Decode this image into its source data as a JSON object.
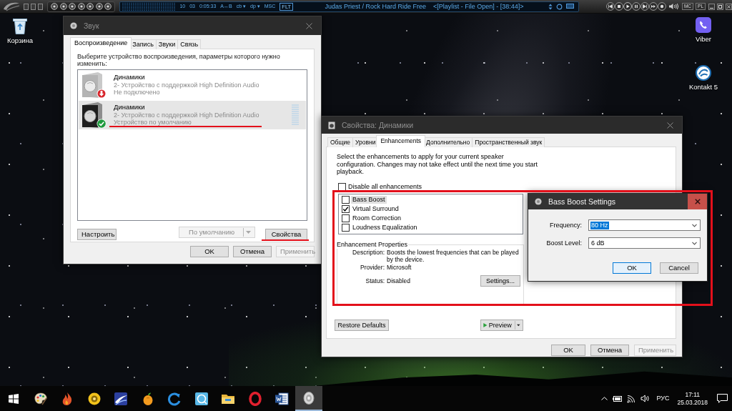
{
  "media_player": {
    "readouts": [
      "10",
      "03",
      "0:05:33",
      "A↔B",
      "cb ▾",
      "dp ▾",
      "MSC"
    ],
    "badge": "FLT",
    "title": "Judas Priest / Rock Hard Ride Free",
    "status": "<[Playlist - File Open] - [38:44]>",
    "buttons": [
      "MC",
      "PL"
    ]
  },
  "desktop_icons": [
    {
      "label": "Корзина",
      "kind": "bin"
    },
    {
      "label": "Viber",
      "kind": "phone"
    },
    {
      "label": "Kontakt 5",
      "kind": "swirl"
    }
  ],
  "sound_window": {
    "title": "Звук",
    "active": false,
    "tabs": [
      {
        "label": "Воспроизведение",
        "selected": true
      },
      {
        "label": "Запись",
        "selected": false
      },
      {
        "label": "Звуки",
        "selected": false
      },
      {
        "label": "Связь",
        "selected": false
      }
    ],
    "instruction": "Выберите устройство воспроизведения, параметры которого нужно изменить:",
    "devices": [
      {
        "name": "Динамики",
        "description": "2- Устройство с поддержкой High Definition Audio",
        "status": "Не подключено",
        "kind": "disconnected",
        "selected": false,
        "underlined": false
      },
      {
        "name": "Динамики",
        "description": "2- Устройство с поддержкой High Definition Audio",
        "status": "Устройство по умолчанию",
        "kind": "default",
        "selected": true,
        "underlined": true
      }
    ],
    "actions": [
      {
        "label": "Настроить",
        "kind": "button",
        "disabled": false,
        "underlined": false
      },
      {
        "label": "По умолчанию",
        "kind": "split",
        "disabled": true,
        "underlined": false
      },
      {
        "label": "Свойства",
        "kind": "button",
        "disabled": false,
        "underlined": true
      }
    ],
    "buttons": [
      {
        "label": "OK",
        "disabled": false
      },
      {
        "label": "Отмена",
        "disabled": false
      },
      {
        "label": "Применить",
        "disabled": true
      }
    ]
  },
  "properties_window": {
    "title": "Свойства: Динамики",
    "active": false,
    "tabs": [
      {
        "label": "Общие",
        "selected": false
      },
      {
        "label": "Уровни",
        "selected": false
      },
      {
        "label": "Enhancements",
        "selected": true
      },
      {
        "label": "Дополнительно",
        "selected": false
      },
      {
        "label": "Пространственный звук",
        "selected": false
      }
    ],
    "intro": "Select the enhancements to apply for your current speaker configuration. Changes may not take effect until the next time you start playback.",
    "disable_all": {
      "label": "Disable all enhancements",
      "checked": false
    },
    "enhancements": [
      {
        "label": "Bass Boost",
        "checked": false,
        "selected": true
      },
      {
        "label": "Virtual Surround",
        "checked": true,
        "selected": false
      },
      {
        "label": "Room Correction",
        "checked": false,
        "selected": false
      },
      {
        "label": "Loudness Equalization",
        "checked": false,
        "selected": false
      }
    ],
    "group": {
      "title": "Enhancement Properties",
      "description_label": "Description:",
      "description": "Boosts the lowest frequencies that can be played by the device.",
      "provider_label": "Provider:",
      "provider": "Microsoft",
      "status_label": "Status:",
      "status": "Disabled",
      "settings_button": "Settings..."
    },
    "restore_button": "Restore Defaults",
    "preview_button": "Preview",
    "buttons": [
      {
        "label": "OK",
        "disabled": false
      },
      {
        "label": "Отмена",
        "disabled": false
      },
      {
        "label": "Применить",
        "disabled": true
      }
    ]
  },
  "bass_boost_dialog": {
    "title": "Bass Boost Settings",
    "active": true,
    "fields": [
      {
        "label": "Frequency:",
        "value": "80 Hz",
        "highlighted": true
      },
      {
        "label": "Boost Level:",
        "value": "6 dB",
        "highlighted": false
      }
    ],
    "buttons": [
      {
        "label": "OK",
        "default": true
      },
      {
        "label": "Cancel",
        "default": false
      }
    ]
  },
  "taskbar": {
    "apps": [
      {
        "kind": "palette",
        "active": false
      },
      {
        "kind": "flame",
        "active": false
      },
      {
        "kind": "disc",
        "active": false
      },
      {
        "kind": "swoosh",
        "active": false
      },
      {
        "kind": "fruit",
        "active": false
      },
      {
        "kind": "arc",
        "active": false
      },
      {
        "kind": "tile",
        "active": false
      },
      {
        "kind": "folder",
        "active": false
      },
      {
        "kind": "ring",
        "active": false
      },
      {
        "kind": "document",
        "active": false
      },
      {
        "kind": "speaker",
        "active": true
      }
    ],
    "language": "РУС",
    "time": "17:11",
    "date": "25.03.2018"
  }
}
